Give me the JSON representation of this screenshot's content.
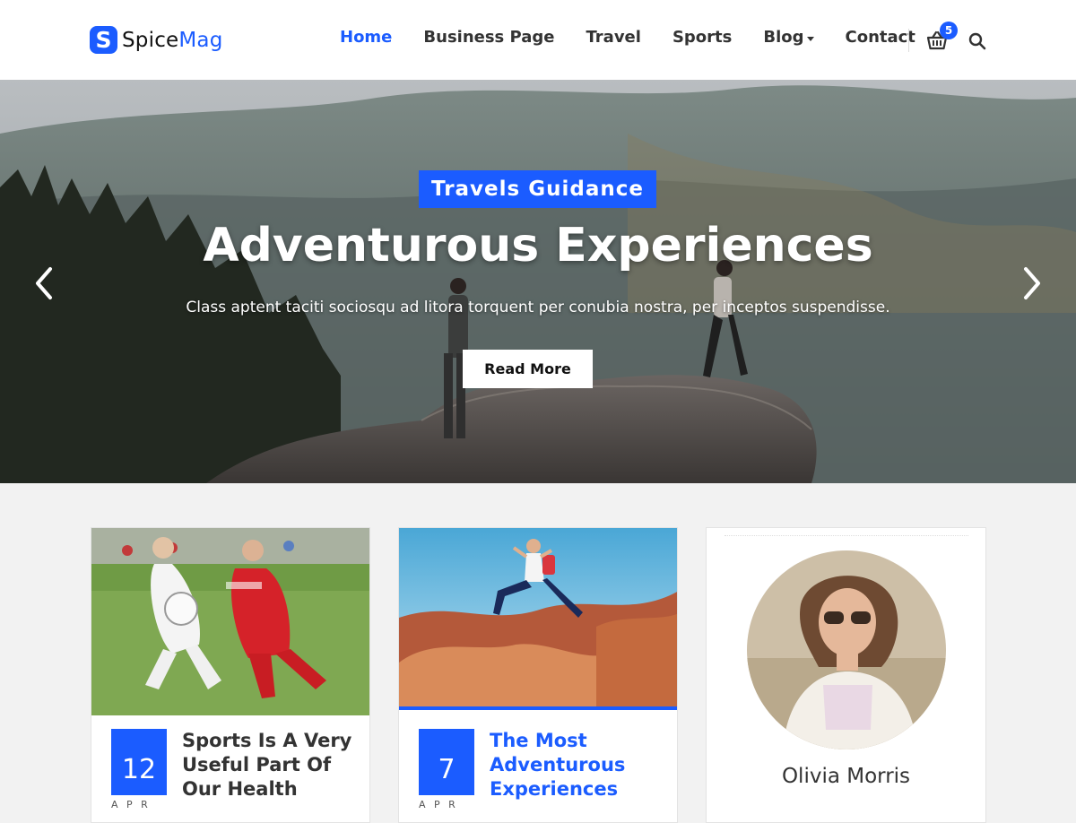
{
  "brand": {
    "logo_letter": "S",
    "name_part1": "Spice",
    "name_part2": "Mag",
    "accent_color": "#1b5cff"
  },
  "nav": {
    "items": [
      {
        "label": "Home",
        "active": true
      },
      {
        "label": "Business Page",
        "active": false
      },
      {
        "label": "Travel",
        "active": false
      },
      {
        "label": "Sports",
        "active": false
      },
      {
        "label": "Blog",
        "active": false,
        "has_dropdown": true
      },
      {
        "label": "Contact",
        "active": false
      }
    ],
    "cart_count": "5",
    "cart_icon": "basket-icon",
    "search_icon": "search-icon"
  },
  "hero": {
    "tag": "Travels Guidance",
    "title": "Adventurous Experiences",
    "subtitle": "Class aptent taciti sociosqu ad litora torquent per conubia nostra, per inceptos suspendisse.",
    "button_label": "Read More",
    "prev_icon": "chevron-left-icon",
    "next_icon": "chevron-right-icon"
  },
  "cards": [
    {
      "day": "12",
      "month": "A P R",
      "title": "Sports Is A Very Useful Part Of Our Health",
      "title_color": "#333333"
    },
    {
      "day": "7",
      "month": "A P R",
      "title": "The Most Adventurous Experiences",
      "title_color": "#1b5cff"
    }
  ],
  "profile": {
    "name": "Olivia Morris"
  }
}
